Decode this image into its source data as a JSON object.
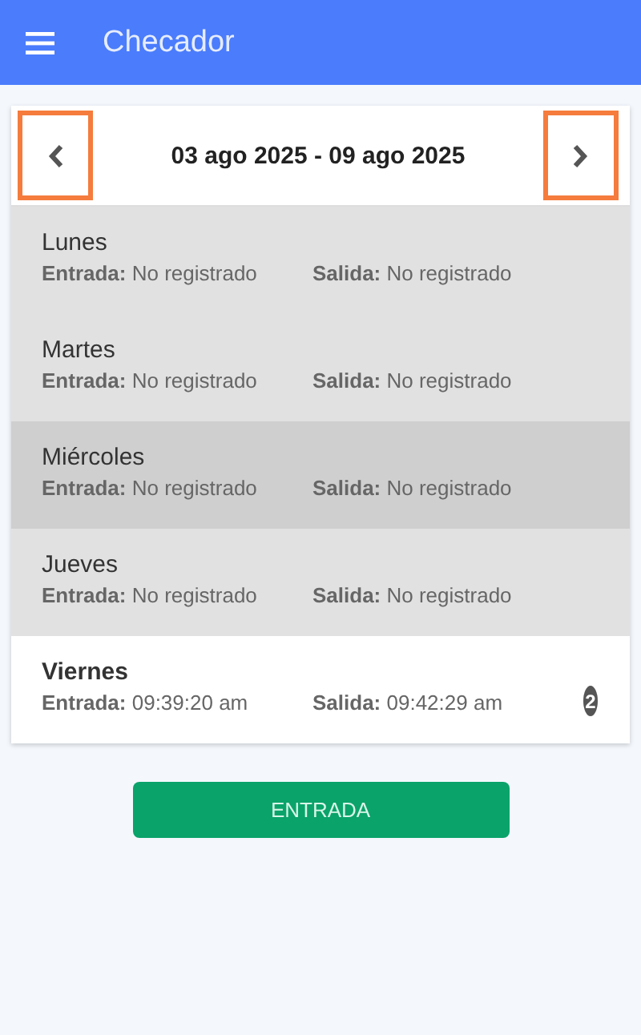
{
  "app_bar": {
    "title": "Checador"
  },
  "week_nav": {
    "range": "03 ago 2025 - 09 ago 2025",
    "prev_highlighted": true,
    "next_highlighted": true
  },
  "days": [
    {
      "name": "Lunes",
      "entry_label": "Entrada:",
      "entry": "No registrado",
      "exit_label": "Salida:",
      "exit": "No registrado",
      "today": false,
      "pressed": false
    },
    {
      "name": "Martes",
      "entry_label": "Entrada:",
      "entry": "No registrado",
      "exit_label": "Salida:",
      "exit": "No registrado",
      "today": false,
      "pressed": false
    },
    {
      "name": "Miércoles",
      "entry_label": "Entrada:",
      "entry": "No registrado",
      "exit_label": "Salida:",
      "exit": "No registrado",
      "today": false,
      "pressed": true
    },
    {
      "name": "Jueves",
      "entry_label": "Entrada:",
      "entry": "No registrado",
      "exit_label": "Salida:",
      "exit": "No registrado",
      "today": false,
      "pressed": false
    },
    {
      "name": "Viernes",
      "entry_label": "Entrada:",
      "entry": "09:39:20 am",
      "exit_label": "Salida:",
      "exit": "09:42:29 am",
      "today": true,
      "pressed": false,
      "count": "2"
    }
  ],
  "action_button": {
    "label": "ENTRADA"
  }
}
